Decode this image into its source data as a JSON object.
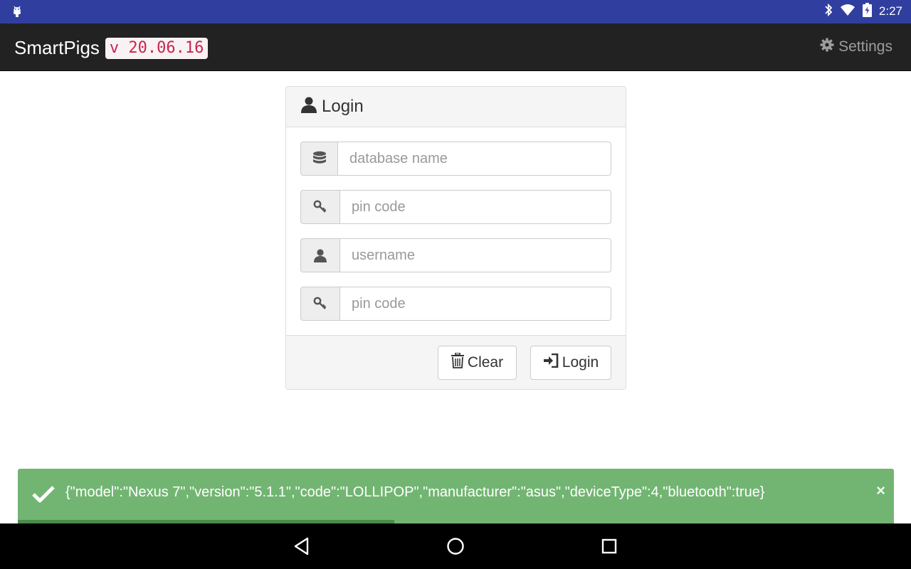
{
  "status_bar": {
    "time": "2:27"
  },
  "app_bar": {
    "brand": "SmartPigs",
    "version": "v 20.06.16",
    "settings_label": "Settings"
  },
  "login": {
    "title": "Login",
    "fields": [
      {
        "placeholder": "database name",
        "value": "",
        "icon": "database-icon"
      },
      {
        "placeholder": "pin code",
        "value": "",
        "icon": "key-icon"
      },
      {
        "placeholder": "username",
        "value": "",
        "icon": "user-icon"
      },
      {
        "placeholder": "pin code",
        "value": "",
        "icon": "key-icon"
      }
    ],
    "clear_label": "Clear",
    "login_label": "Login"
  },
  "toast": {
    "message": "{\"model\":\"Nexus 7\",\"version\":\"5.1.1\",\"code\":\"LOLLIPOP\",\"manufacturer\":\"asus\",\"deviceType\":4,\"bluetooth\":true}",
    "progress": 0.43,
    "close_symbol": "×"
  },
  "colors": {
    "status_bar": "#303F9F",
    "app_bar": "#222222",
    "toast": "#72b572",
    "version_text": "#c7254e"
  }
}
